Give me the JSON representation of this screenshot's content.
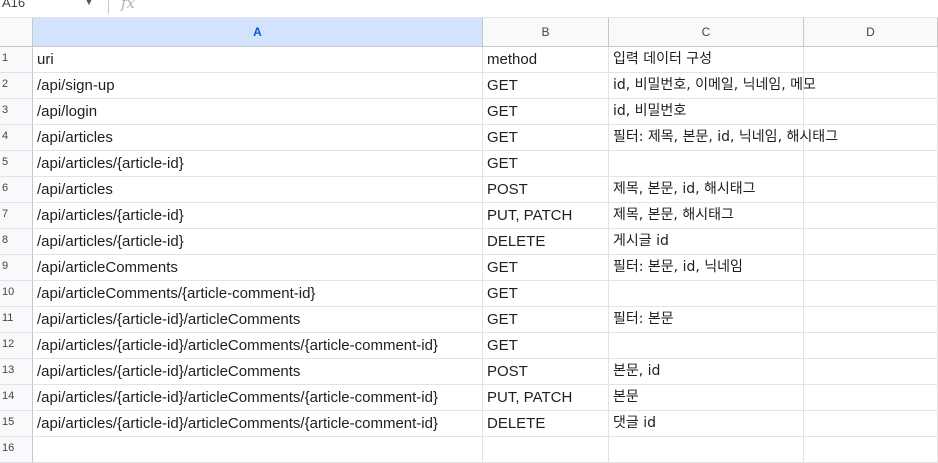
{
  "formula_bar": {
    "name_box": "A16",
    "fx_icon": "fx"
  },
  "columns": [
    {
      "label": "A",
      "selected": true
    },
    {
      "label": "B",
      "selected": false
    },
    {
      "label": "C",
      "selected": false
    },
    {
      "label": "D",
      "selected": false
    }
  ],
  "rows": [
    {
      "num": "1",
      "cells": [
        "uri",
        "method",
        "입력 데이터 구성",
        ""
      ]
    },
    {
      "num": "2",
      "cells": [
        "/api/sign-up",
        "GET",
        "id, 비밀번호, 이메일, 닉네임, 메모",
        ""
      ]
    },
    {
      "num": "3",
      "cells": [
        "/api/login",
        "GET",
        "id, 비밀번호",
        ""
      ]
    },
    {
      "num": "4",
      "cells": [
        "/api/articles",
        "GET",
        "필터: 제목, 본문, id, 닉네임, 해시태그",
        ""
      ]
    },
    {
      "num": "5",
      "cells": [
        "/api/articles/{article-id}",
        "GET",
        "",
        ""
      ]
    },
    {
      "num": "6",
      "cells": [
        "/api/articles",
        "POST",
        "제목, 본문, id, 해시태그",
        ""
      ]
    },
    {
      "num": "7",
      "cells": [
        "/api/articles/{article-id}",
        "PUT, PATCH",
        "제목, 본문, 해시태그",
        ""
      ]
    },
    {
      "num": "8",
      "cells": [
        "/api/articles/{article-id}",
        "DELETE",
        "게시글 id",
        ""
      ]
    },
    {
      "num": "9",
      "cells": [
        "/api/articleComments",
        "GET",
        "필터: 본문, id, 닉네임",
        ""
      ]
    },
    {
      "num": "10",
      "cells": [
        "/api/articleComments/{article-comment-id}",
        "GET",
        "",
        ""
      ]
    },
    {
      "num": "11",
      "cells": [
        "/api/articles/{article-id}/articleComments",
        "GET",
        "필터: 본문",
        ""
      ]
    },
    {
      "num": "12",
      "cells": [
        "/api/articles/{article-id}/articleComments/{article-comment-id}",
        "GET",
        "",
        ""
      ]
    },
    {
      "num": "13",
      "cells": [
        "/api/articles/{article-id}/articleComments",
        "POST",
        "본문, id",
        ""
      ]
    },
    {
      "num": "14",
      "cells": [
        "/api/articles/{article-id}/articleComments/{article-comment-id}",
        "PUT, PATCH",
        "본문",
        ""
      ]
    },
    {
      "num": "15",
      "cells": [
        "/api/articles/{article-id}/articleComments/{article-comment-id}",
        "DELETE",
        "댓글 id",
        ""
      ]
    },
    {
      "num": "16",
      "cells": [
        "",
        "",
        "",
        ""
      ]
    }
  ]
}
